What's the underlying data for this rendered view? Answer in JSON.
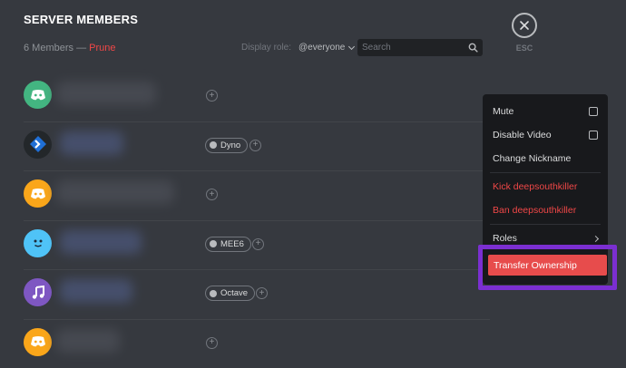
{
  "header": {
    "title": "SERVER MEMBERS",
    "member_count": "6 Members",
    "dash": " — ",
    "prune_label": "Prune",
    "display_role_label": "Display role:",
    "display_role_value": "@everyone",
    "search_placeholder": "Search",
    "esc_label": "ESC"
  },
  "members": [
    {
      "avatar_color": "#43b581",
      "avatar_icon": "discord-logo-icon",
      "role": ""
    },
    {
      "avatar_color": "#23272a",
      "avatar_icon": "dyno-logo-icon",
      "role": "Dyno"
    },
    {
      "avatar_color": "#faa61a",
      "avatar_icon": "discord-logo-icon",
      "role": ""
    },
    {
      "avatar_color": "#4fc3f7",
      "avatar_icon": "mee6-face-icon",
      "role": "MEE6"
    },
    {
      "avatar_color": "#7e57c2",
      "avatar_icon": "music-note-icon",
      "role": "Octave"
    },
    {
      "avatar_color": "#faa61a",
      "avatar_icon": "discord-logo-icon",
      "role": ""
    }
  ],
  "context_menu": {
    "mute": "Mute",
    "disable_video": "Disable Video",
    "change_nickname": "Change Nickname",
    "kick": "Kick deepsouthkiller",
    "ban": "Ban deepsouthkiller",
    "roles": "Roles",
    "transfer_ownership": "Transfer Ownership"
  },
  "colors": {
    "background": "#36393f",
    "danger": "#f04747",
    "highlight": "#7b2fd1",
    "transfer_button": "#e74c4c"
  }
}
